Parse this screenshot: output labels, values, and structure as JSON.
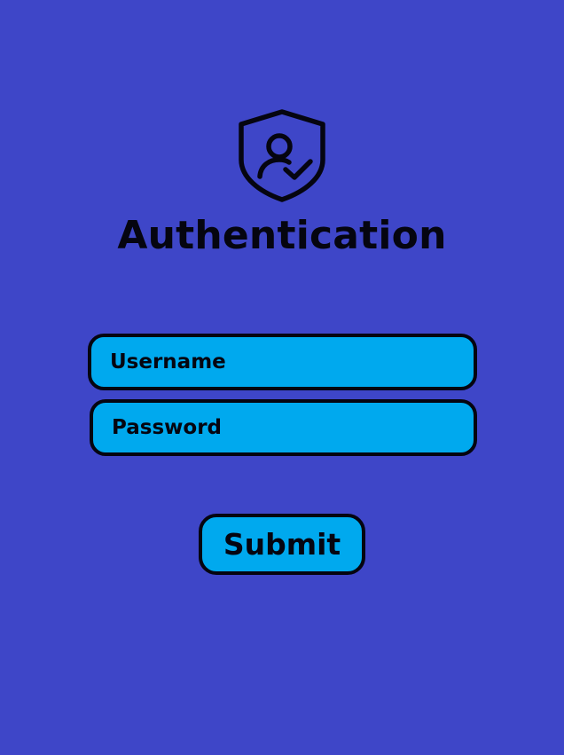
{
  "header": {
    "icon": "shield-user-check-icon",
    "title": "Authentication"
  },
  "form": {
    "username_placeholder": "Username",
    "password_placeholder": "Password",
    "submit_label": "Submit"
  },
  "colors": {
    "background": "#3e46c8",
    "field_fill": "#00a9ee",
    "outline": "#050510"
  }
}
